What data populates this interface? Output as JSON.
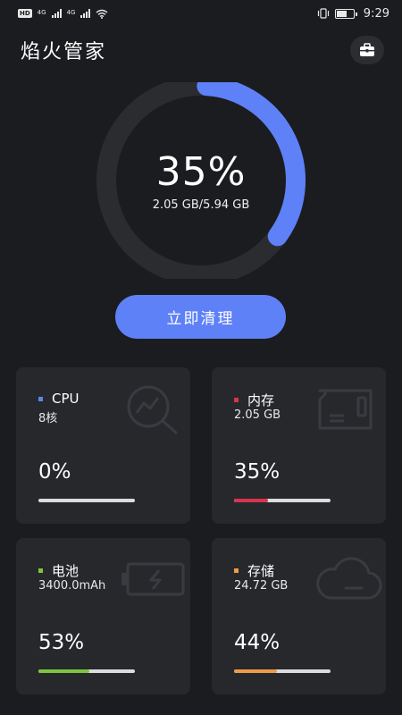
{
  "status_bar": {
    "hd": "HD",
    "net1": "4G",
    "net2": "4G",
    "time": "9:29"
  },
  "header": {
    "title": "焰火管家",
    "toolbox_icon": "briefcase-icon"
  },
  "memory_gauge": {
    "percent_text": "35%",
    "usage_text": "2.05 GB/5.94 GB",
    "fraction": 0.35,
    "track_color": "#2b2c30",
    "arc_color": "#5f81f7"
  },
  "clean_button": {
    "label": "立即清理",
    "color": "#5f81f7"
  },
  "cards": {
    "cpu": {
      "title": "CPU",
      "subtitle": "8核",
      "percent_text": "0%",
      "fraction": 0.0,
      "accent": "#5b86e5",
      "icon": "chart-search-icon"
    },
    "memory": {
      "title": "内存",
      "subtitle": "2.05 GB",
      "percent_text": "35%",
      "fraction": 0.35,
      "accent": "#d9344e",
      "icon": "memory-card-icon"
    },
    "battery": {
      "title": "电池",
      "subtitle": "3400.0mAh",
      "percent_text": "53%",
      "fraction": 0.53,
      "accent": "#7cc441",
      "icon": "battery-charging-icon"
    },
    "storage": {
      "title": "存储",
      "subtitle": "24.72 GB",
      "percent_text": "44%",
      "fraction": 0.44,
      "accent": "#ee9a4a",
      "icon": "cloud-icon"
    }
  }
}
